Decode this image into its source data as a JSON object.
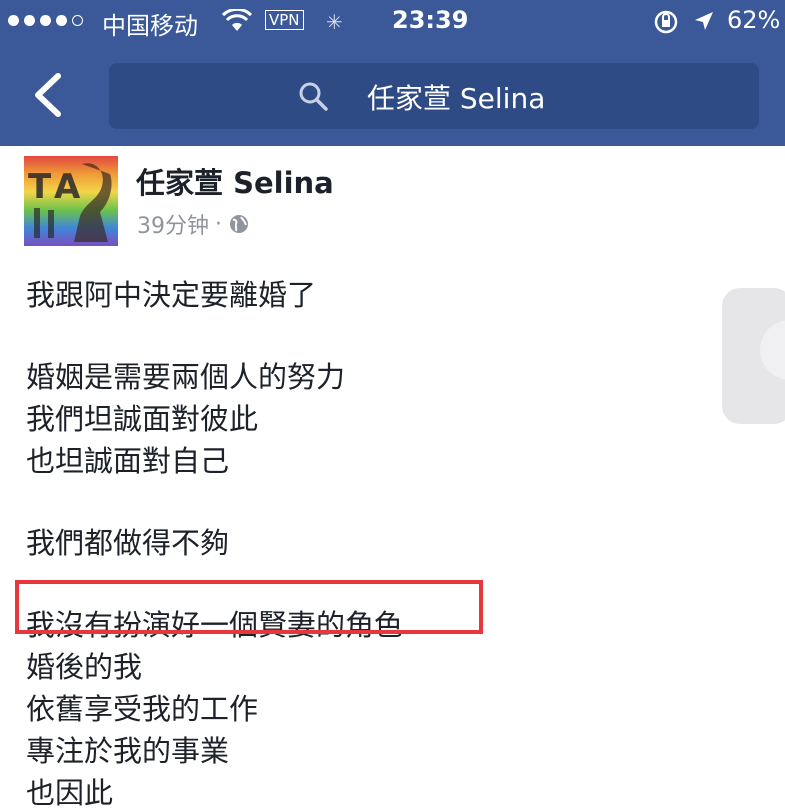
{
  "status_bar": {
    "carrier": "中国移动",
    "vpn": "VPN",
    "time": "23:39",
    "battery": "62%"
  },
  "nav": {
    "search_query": "任家萱 Selina"
  },
  "post": {
    "author": "任家萱 Selina",
    "time_ago": "39分钟",
    "separator": "·",
    "lines": [
      "我跟阿中決定要離婚了",
      "婚姻是需要兩個人的努力",
      "我們坦誠面對彼此",
      "也坦誠面對自己",
      "我們都做得不夠",
      "我沒有扮演好一個賢妻的角色",
      "婚後的我",
      "依舊享受我的工作",
      "專注於我的事業",
      "也因此"
    ]
  },
  "colors": {
    "header_bg": "#3b5998",
    "search_bg": "#2f4b86",
    "highlight_border": "#e8363d",
    "meta_text": "#90949c"
  },
  "icons": [
    "back-chevron-icon",
    "search-icon",
    "wifi-icon",
    "lock-rotation-icon",
    "location-arrow-icon",
    "globe-icon"
  ]
}
